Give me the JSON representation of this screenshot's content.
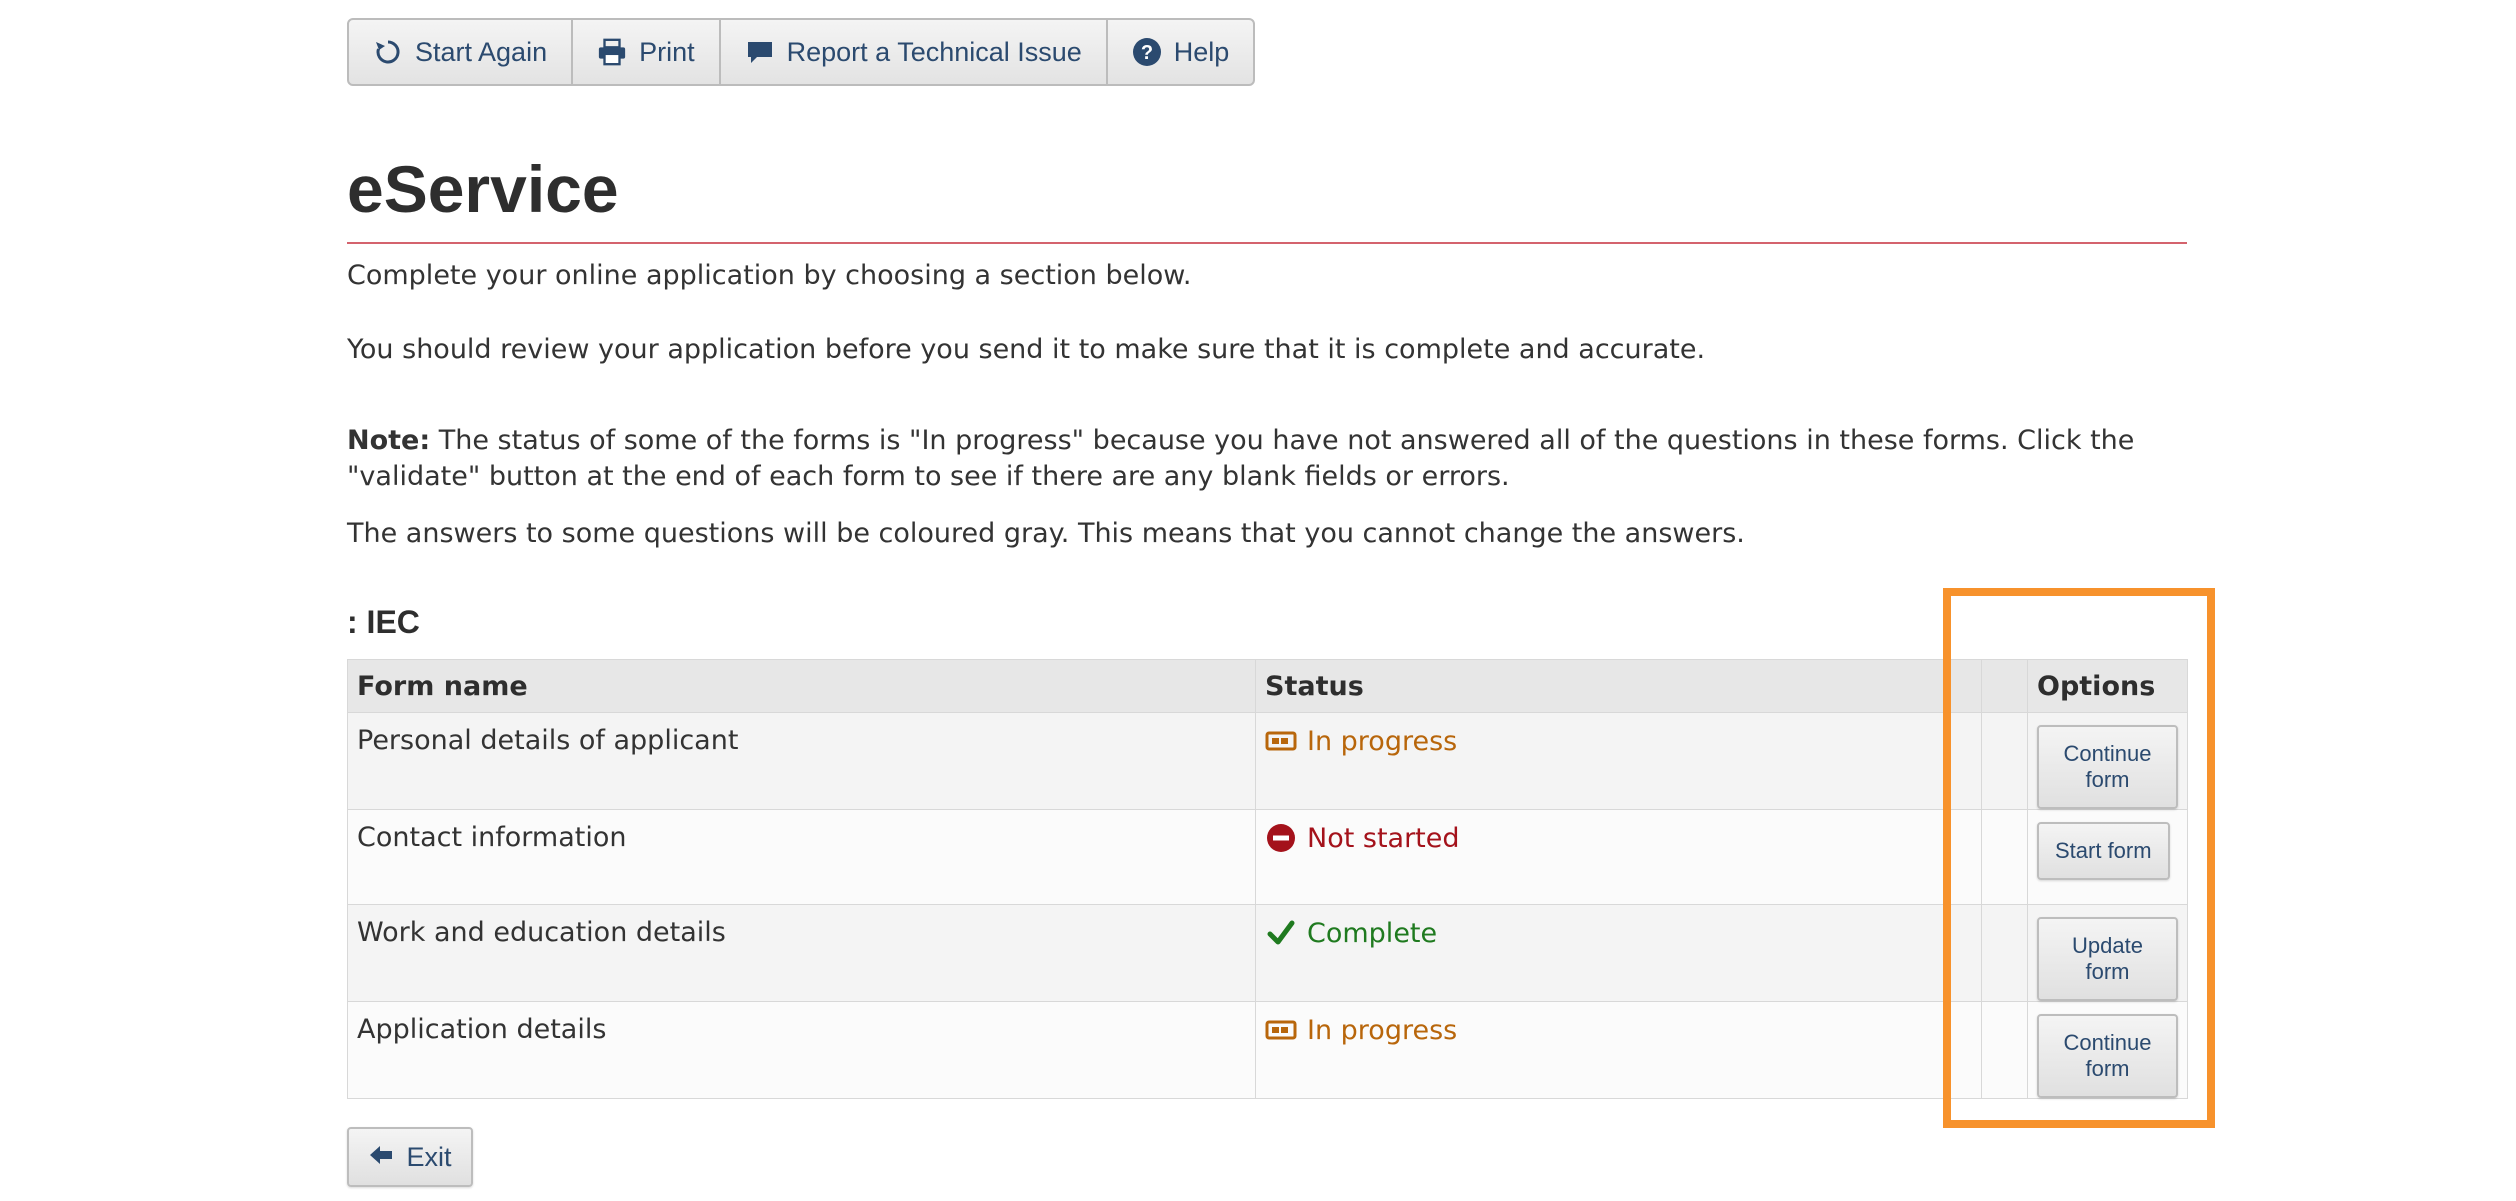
{
  "toolbar": {
    "items": [
      {
        "label": "Start Again",
        "icon": "refresh-icon"
      },
      {
        "label": "Print",
        "icon": "printer-icon"
      },
      {
        "label": "Report a Technical Issue",
        "icon": "comment-icon"
      },
      {
        "label": "Help",
        "icon": "help-icon"
      }
    ]
  },
  "page": {
    "title": "eService",
    "intro": "Complete your online application by choosing a section below.",
    "review": "You should review your application before you send it to make sure that it is complete and accurate.",
    "note_label": "Note:",
    "note_text": " The status of some of the forms is \"In progress\" because you have not answered all of the questions in these forms. Click the \"validate\" button at the end of each form to see if there are any blank fields or errors.",
    "gray_note": "The answers to some questions will be coloured gray. This means that you cannot change the answers.",
    "section_title": ": IEC"
  },
  "table": {
    "headers": {
      "form_name": "Form name",
      "status": "Status",
      "spacer": "",
      "options": "Options"
    },
    "rows": [
      {
        "form_name": "Personal details of applicant",
        "status": "In progress",
        "status_icon": "in-progress-icon",
        "status_color": "#b8660b",
        "option": "Continue form"
      },
      {
        "form_name": "Contact information",
        "status": "Not started",
        "status_icon": "not-started-icon",
        "status_color": "#a4121b",
        "option": "Start form"
      },
      {
        "form_name": "Work and education details",
        "status": "Complete",
        "status_icon": "check-icon",
        "status_color": "#1f7a1f",
        "option": "Update form"
      },
      {
        "form_name": "Application details",
        "status": "In progress",
        "status_icon": "in-progress-icon",
        "status_color": "#b8660b",
        "option": "Continue form"
      }
    ]
  },
  "exit": {
    "label": "Exit",
    "icon": "arrow-left-icon"
  },
  "colors": {
    "accent": "#2b4a6f",
    "title_rule": "#d4636d",
    "highlight": "#f7922c"
  }
}
